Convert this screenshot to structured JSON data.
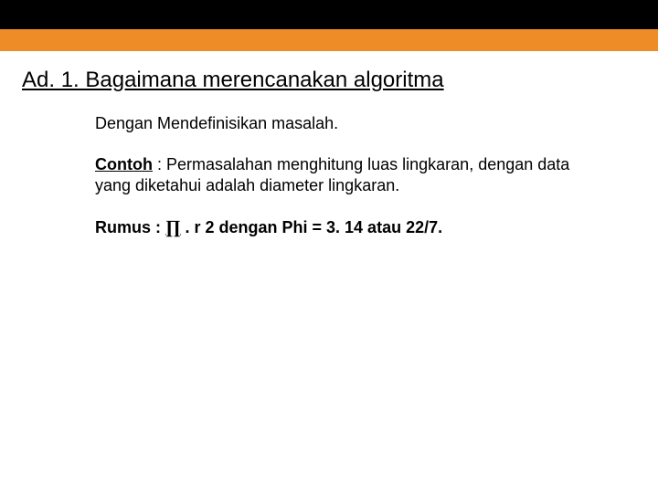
{
  "heading": "Ad. 1.  Bagaimana merencanakan algoritma",
  "body": {
    "p1": "Dengan Mendefinisikan masalah.",
    "p2_label": "Contoh",
    "p2_rest": " : Permasalahan menghitung luas lingkaran, dengan data yang diketahui adalah diameter lingkaran.",
    "formula_label": "Rumus : ",
    "formula_pi": "∏",
    "formula_rest": " . r 2 dengan  Phi =  3. 14 atau 22/7."
  }
}
